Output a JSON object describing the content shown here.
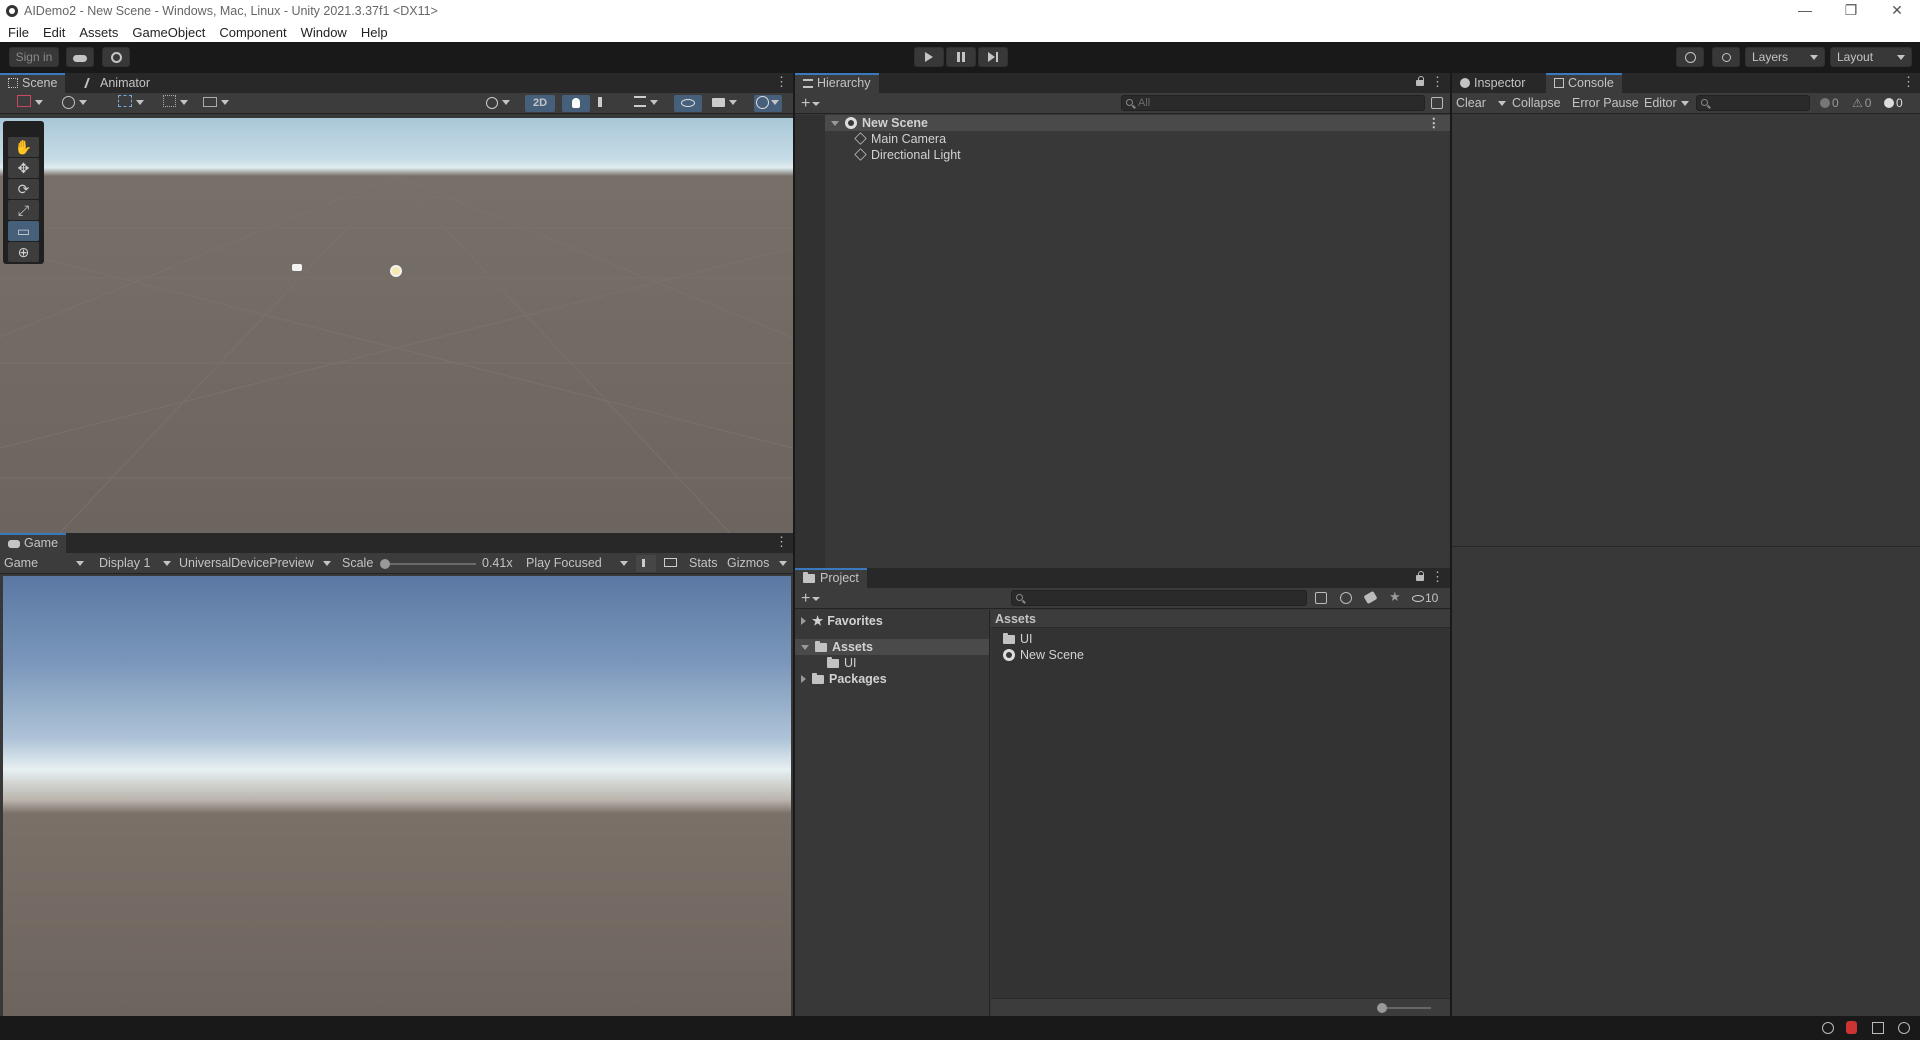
{
  "window": {
    "title": "AIDemo2 - New Scene - Windows, Mac, Linux - Unity 2021.3.37f1 <DX11>",
    "minimize": "—",
    "restore": "❐",
    "close": "✕"
  },
  "menu": [
    "File",
    "Edit",
    "Assets",
    "GameObject",
    "Component",
    "Window",
    "Help"
  ],
  "toolbar": {
    "sign_in": "Sign in",
    "layers": "Layers",
    "layout": "Layout"
  },
  "scene_panel": {
    "tabs": [
      "Scene",
      "Animator"
    ],
    "toggle_2d": "2D",
    "tools": [
      "✋",
      "✥",
      "⟳",
      "⤢",
      "▭",
      "⊕"
    ]
  },
  "game_panel": {
    "tab": "Game",
    "mode": "Game",
    "display": "Display 1",
    "device": "UniversalDevicePreview",
    "scale_label": "Scale",
    "scale_value": "0.41x",
    "play_focused": "Play Focused",
    "stats": "Stats",
    "gizmos": "Gizmos",
    "scale_level": 0.0
  },
  "hierarchy": {
    "tab": "Hierarchy",
    "search_placeholder": "All",
    "scene": "New Scene",
    "objects": [
      "Main Camera",
      "Directional Light"
    ]
  },
  "project": {
    "tab": "Project",
    "hidden_count": "10",
    "tree": {
      "favorites": "Favorites",
      "assets": "Assets",
      "assets_children": [
        "UI"
      ],
      "packages": "Packages"
    },
    "breadcrumb": "Assets",
    "items": [
      {
        "name": "UI",
        "type": "folder"
      },
      {
        "name": "New Scene",
        "type": "scene"
      }
    ]
  },
  "inspector_tab": "Inspector",
  "console": {
    "tab": "Console",
    "clear": "Clear",
    "collapse": "Collapse",
    "error_pause": "Error Pause",
    "editor": "Editor",
    "log_count": "0",
    "warn_count": "0",
    "error_count": "0"
  },
  "colors": {
    "accent": "#3a79bb",
    "panel": "#383838",
    "background": "#191919"
  }
}
